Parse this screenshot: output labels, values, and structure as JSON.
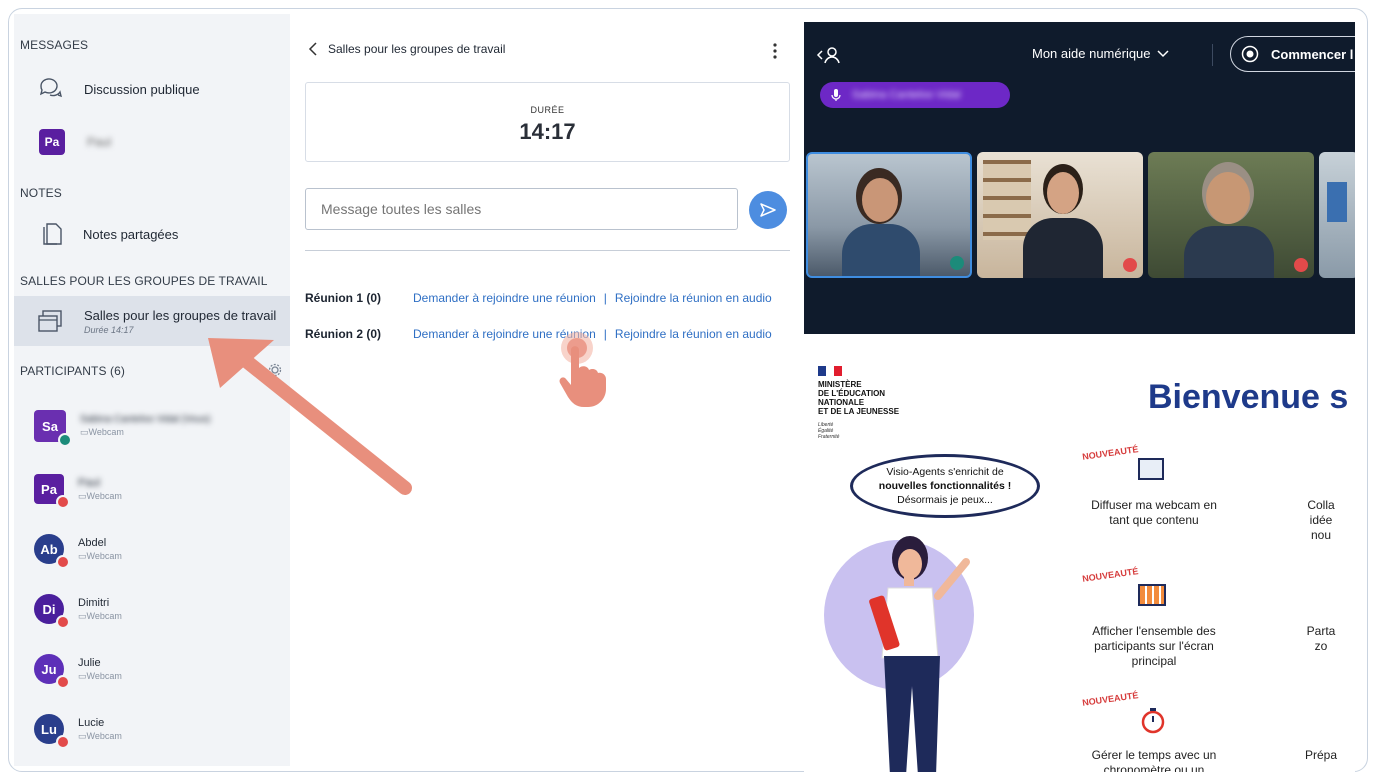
{
  "sidebar": {
    "messages_title": "MESSAGES",
    "public_chat": "Discussion publique",
    "user_initials": "Pa",
    "user_name": "Paul",
    "notes_title": "NOTES",
    "shared_notes": "Notes partagées",
    "breakout_title": "SALLES POUR LES GROUPES DE TRAVAIL",
    "breakout_item": "Salles pour les groupes de travail",
    "breakout_sub": "Durée 14:17",
    "participants_title": "PARTICIPANTS (6)",
    "participants": [
      {
        "initials": "Sa",
        "name": "Sabina Canteloo Vidal (Vous)",
        "sub": "Webcam",
        "color": "#6a2fb0"
      },
      {
        "initials": "Pa",
        "name": "Paul",
        "sub": "Webcam",
        "color": "#5a1fa0"
      },
      {
        "initials": "Ab",
        "name": "Abdel",
        "sub": "Webcam",
        "color": "#2a3e8c"
      },
      {
        "initials": "Di",
        "name": "Dimitri",
        "sub": "Webcam",
        "color": "#4a1f9c"
      },
      {
        "initials": "Ju",
        "name": "Julie",
        "sub": "Webcam",
        "color": "#5d2fb8"
      },
      {
        "initials": "Lu",
        "name": "Lucie",
        "sub": "Webcam",
        "color": "#2a3e8c"
      }
    ]
  },
  "middle": {
    "header_title": "Salles pour les groupes de travail",
    "duree_label": "DURÉE",
    "duree_value": "14:17",
    "message_placeholder": "Message toutes les salles",
    "rooms": [
      {
        "name": "Réunion 1 (0)",
        "join": "Demander à rejoindre une réunion",
        "audio": "Rejoindre la réunion en audio"
      },
      {
        "name": "Réunion 2 (0)",
        "join": "Demander à rejoindre une réunion",
        "audio": "Rejoindre la réunion en audio"
      }
    ]
  },
  "video": {
    "help_label": "Mon aide numérique",
    "start_label": "Commencer l",
    "speaker_name": "Sabina Canteloo Vidal"
  },
  "doc": {
    "ministry": [
      "MINISTÈRE",
      "DE L'ÉDUCATION",
      "NATIONALE",
      "ET DE LA JEUNESSE"
    ],
    "motto": [
      "Liberté",
      "Égalité",
      "Fraternité"
    ],
    "welcome": "Bienvenue s",
    "bubble": [
      "Visio-Agents s'enrichit de",
      "nouvelles fonctionnalités !",
      "Désormais je peux..."
    ],
    "badge": "NOUVEAUTÉ",
    "features": [
      [
        "Diffuser ma webcam en",
        "tant que contenu"
      ],
      [
        "Afficher l'ensemble des",
        "participants sur l'écran",
        "principal"
      ],
      [
        "Gérer le temps avec un",
        "chronomètre ou un"
      ]
    ],
    "right_col": [
      [
        "Colla",
        "idée",
        "nou"
      ],
      [
        "Parta",
        "zo"
      ],
      [
        "Prépa"
      ]
    ]
  },
  "colors": {
    "accent_blue": "#4d8de0",
    "link_blue": "#2f6fc4",
    "arrow": "#e88f7d",
    "navy": "#0f1b2c",
    "ministry_blue": "#1e3a8a"
  }
}
